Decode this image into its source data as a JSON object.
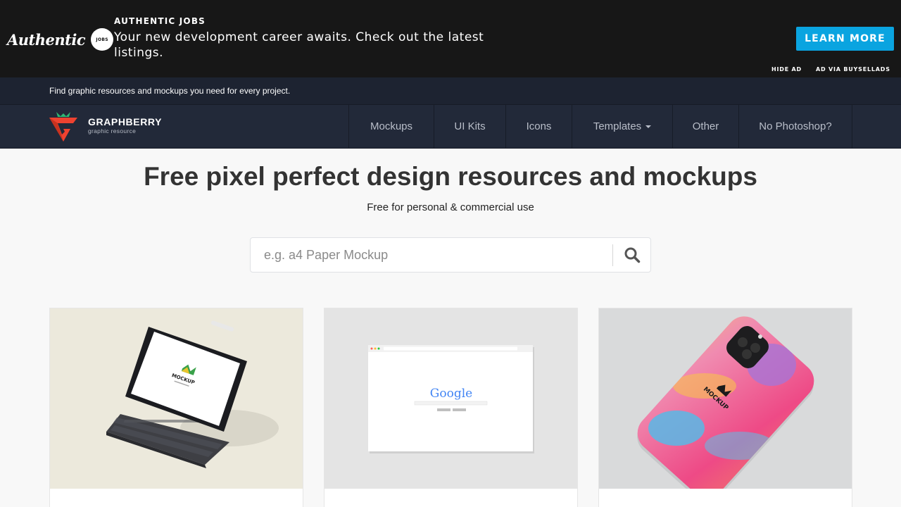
{
  "ad": {
    "logo_script": "Authentic",
    "logo_badge": "JOBS",
    "heading": "AUTHENTIC JOBS",
    "body": "Your new development career awaits. Check out the latest listings.",
    "cta": "LEARN MORE",
    "hide": "HIDE AD",
    "via": "AD VIA BUYSELLADS",
    "cta_color": "#0aa4e0"
  },
  "tagline": "Find graphic resources and mockups you need for every project.",
  "brand": {
    "name": "GRAPHBERRY",
    "sub": "graphic resource",
    "accent": "#ee4230",
    "leaf": "#2fb673"
  },
  "nav": {
    "items": [
      {
        "label": "Mockups"
      },
      {
        "label": "UI Kits"
      },
      {
        "label": "Icons"
      },
      {
        "label": "Templates",
        "dropdown": true
      },
      {
        "label": "Other"
      },
      {
        "label": "No Photoshop?"
      }
    ]
  },
  "hero": {
    "title": "Free pixel perfect design resources and mockups",
    "subtitle": "Free for personal & commercial use"
  },
  "search": {
    "placeholder": "e.g. a4 Paper Mockup",
    "icon": "search-icon"
  },
  "cards": [
    {
      "image": "ipad-keyboard-mockup",
      "mock_label": "MOCKUP"
    },
    {
      "image": "browser-window-mockup",
      "mock_label": "Google"
    },
    {
      "image": "phone-case-mockup",
      "mock_label": "MOCKUP"
    }
  ]
}
